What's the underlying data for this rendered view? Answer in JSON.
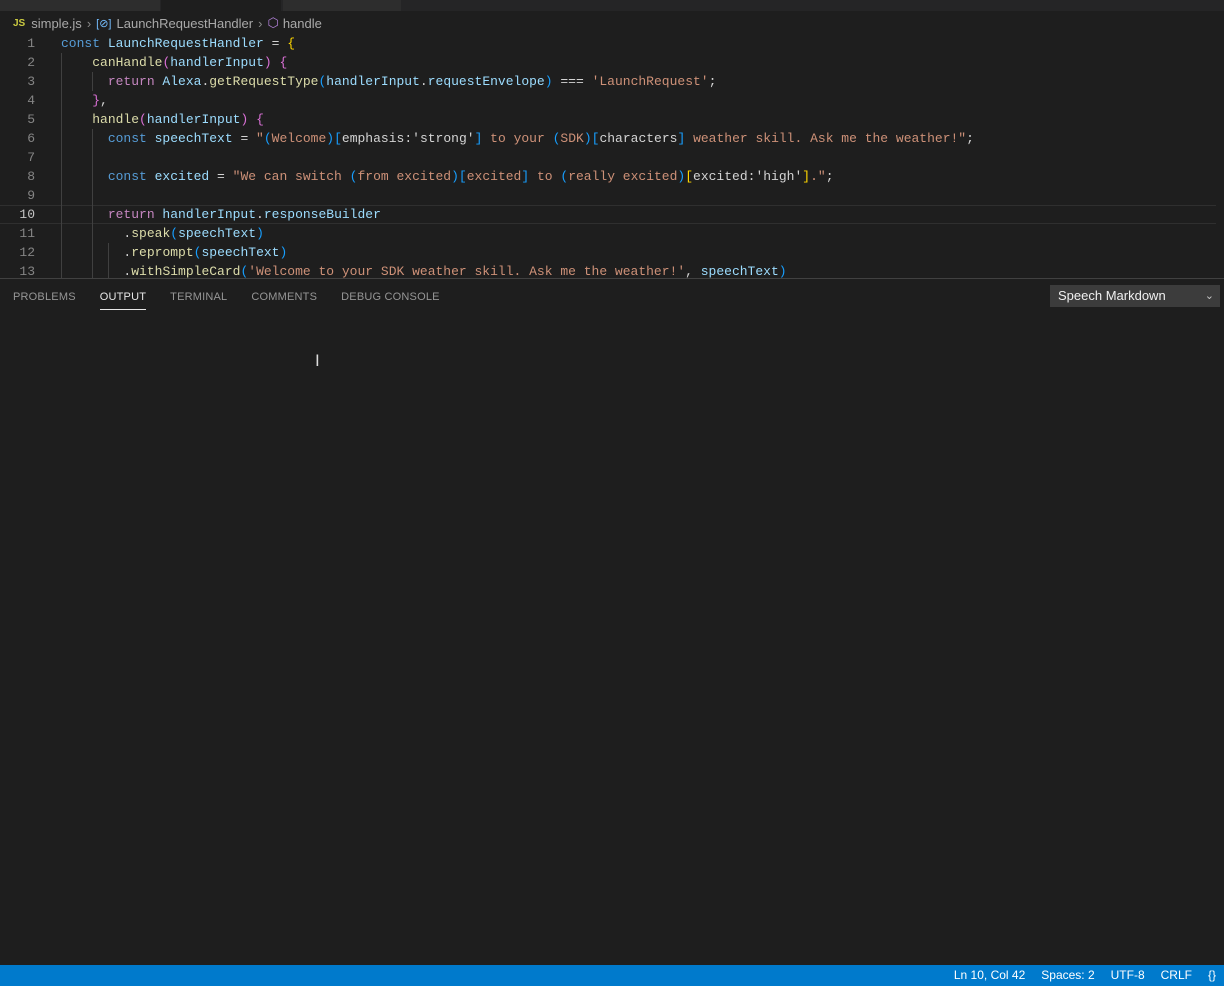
{
  "breadcrumb": {
    "file": "simple.js",
    "file_icon": "JS",
    "symbol": "LaunchRequestHandler",
    "method": "handle"
  },
  "editor": {
    "current_line": 10,
    "lines": [
      {
        "n": "1",
        "tokens": [
          [
            "const ",
            "k"
          ],
          [
            "LaunchRequestHandler",
            "v"
          ],
          [
            " = ",
            "p"
          ],
          [
            "{",
            "b1"
          ]
        ]
      },
      {
        "n": "2",
        "tokens": [
          [
            "    ",
            "w"
          ],
          [
            "canHandle",
            "f"
          ],
          [
            "(",
            "b2"
          ],
          [
            "handlerInput",
            "v"
          ],
          [
            ") ",
            "b2"
          ],
          [
            "{",
            "b2"
          ]
        ]
      },
      {
        "n": "3",
        "tokens": [
          [
            "      ",
            "w"
          ],
          [
            "return ",
            "kc"
          ],
          [
            "Alexa",
            "v"
          ],
          [
            ".",
            "p"
          ],
          [
            "getRequestType",
            "f"
          ],
          [
            "(",
            "b3"
          ],
          [
            "handlerInput",
            "v"
          ],
          [
            ".",
            "p"
          ],
          [
            "requestEnvelope",
            "v"
          ],
          [
            ")",
            "b3"
          ],
          [
            " === ",
            "p"
          ],
          [
            "'LaunchRequest'",
            "s"
          ],
          [
            ";",
            "p"
          ]
        ]
      },
      {
        "n": "4",
        "tokens": [
          [
            "    ",
            "w"
          ],
          [
            "}",
            "b2"
          ],
          [
            ",",
            "p"
          ]
        ]
      },
      {
        "n": "5",
        "tokens": [
          [
            "    ",
            "w"
          ],
          [
            "handle",
            "f"
          ],
          [
            "(",
            "b2"
          ],
          [
            "handlerInput",
            "v"
          ],
          [
            ") ",
            "b2"
          ],
          [
            "{",
            "b2"
          ]
        ]
      },
      {
        "n": "6",
        "tokens": [
          [
            "      ",
            "w"
          ],
          [
            "const ",
            "k"
          ],
          [
            "speechText",
            "v"
          ],
          [
            " = ",
            "p"
          ],
          [
            "\"",
            "s"
          ],
          [
            "(",
            "b3"
          ],
          [
            "Welcome",
            "s"
          ],
          [
            ")",
            "b3"
          ],
          [
            "[",
            "b3"
          ],
          [
            "emphasis",
            "w"
          ],
          [
            ":",
            "p"
          ],
          [
            "'strong'",
            "w"
          ],
          [
            "]",
            "b3"
          ],
          [
            " to your ",
            "s"
          ],
          [
            "(",
            "b3"
          ],
          [
            "SDK",
            "s"
          ],
          [
            ")",
            "b3"
          ],
          [
            "[",
            "b3"
          ],
          [
            "characters",
            "w"
          ],
          [
            "]",
            "b3"
          ],
          [
            " weather skill. Ask me the weather!\"",
            "s"
          ],
          [
            ";",
            "p"
          ]
        ]
      },
      {
        "n": "7",
        "tokens": []
      },
      {
        "n": "8",
        "tokens": [
          [
            "      ",
            "w"
          ],
          [
            "const ",
            "k"
          ],
          [
            "excited",
            "v"
          ],
          [
            " = ",
            "p"
          ],
          [
            "\"We can switch ",
            "s"
          ],
          [
            "(",
            "b3"
          ],
          [
            "from excited",
            "s"
          ],
          [
            ")",
            "b3"
          ],
          [
            "[",
            "b3"
          ],
          [
            "excited",
            "s"
          ],
          [
            "]",
            "b3"
          ],
          [
            " to ",
            "s"
          ],
          [
            "(",
            "b3"
          ],
          [
            "really excited",
            "s"
          ],
          [
            ")",
            "b3"
          ],
          [
            "[",
            "b1"
          ],
          [
            "excited",
            "w"
          ],
          [
            ":",
            "p"
          ],
          [
            "'high'",
            "w"
          ],
          [
            "]",
            "b1"
          ],
          [
            ".\"",
            "s"
          ],
          [
            ";",
            "p"
          ]
        ]
      },
      {
        "n": "9",
        "tokens": []
      },
      {
        "n": "10",
        "tokens": [
          [
            "      ",
            "w"
          ],
          [
            "return ",
            "kc"
          ],
          [
            "handlerInput",
            "v"
          ],
          [
            ".",
            "p"
          ],
          [
            "responseBuilder",
            "v"
          ]
        ]
      },
      {
        "n": "11",
        "tokens": [
          [
            "        ",
            "w"
          ],
          [
            ".",
            "p"
          ],
          [
            "speak",
            "f"
          ],
          [
            "(",
            "b3"
          ],
          [
            "speechText",
            "v"
          ],
          [
            ")",
            "b3"
          ]
        ]
      },
      {
        "n": "12",
        "tokens": [
          [
            "        ",
            "w"
          ],
          [
            ".",
            "p"
          ],
          [
            "reprompt",
            "f"
          ],
          [
            "(",
            "b3"
          ],
          [
            "speechText",
            "v"
          ],
          [
            ")",
            "b3"
          ]
        ]
      },
      {
        "n": "13",
        "tokens": [
          [
            "        ",
            "w"
          ],
          [
            ".",
            "p"
          ],
          [
            "withSimpleCard",
            "f"
          ],
          [
            "(",
            "b3"
          ],
          [
            "'Welcome to your SDK weather skill. Ask me the weather!'",
            "s"
          ],
          [
            ", ",
            "p"
          ],
          [
            "speechText",
            "v"
          ],
          [
            ")",
            "b3"
          ]
        ]
      }
    ]
  },
  "panel": {
    "tabs": [
      "PROBLEMS",
      "OUTPUT",
      "TERMINAL",
      "COMMENTS",
      "DEBUG CONSOLE"
    ],
    "active_tab": "OUTPUT",
    "channel": "Speech Markdown"
  },
  "status": {
    "position": "Ln 10, Col 42",
    "spaces": "Spaces: 2",
    "encoding": "UTF-8",
    "eol": "CRLF",
    "language_icon": "{}"
  },
  "colors": {
    "status_bar": "#007acc",
    "editor_bg": "#1e1e1e"
  }
}
